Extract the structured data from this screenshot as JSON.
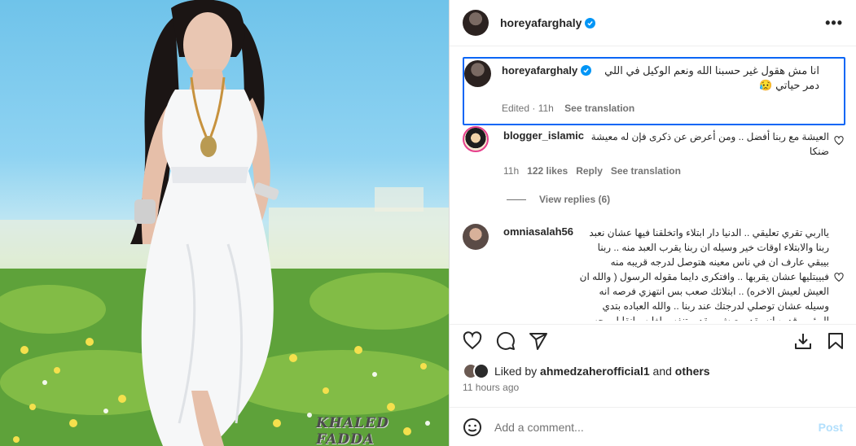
{
  "post": {
    "image_alt_icon": "photo",
    "watermark": "KHALED FADDA"
  },
  "header": {
    "username": "horeyafarghaly",
    "more_label": "•••"
  },
  "caption": {
    "username": "horeyafarghaly",
    "text": "انا مش هقول غير حسبنا الله ونعم الوكيل في اللي دمر حياتي 😥",
    "edited": "Edited · 11h",
    "see_translation": "See translation"
  },
  "comments": [
    {
      "username": "blogger_islamic",
      "text": "العيشة مع ربنا أفضل .. ومن أعرض عن ذكرى فإن له معيشة ضنكا",
      "time": "11h",
      "likes": "122 likes",
      "reply": "Reply",
      "see_translation": "See translation",
      "view_replies": "View replies (6)"
    },
    {
      "username": "omniasalah56",
      "text": "يااربي تقري تعليقي .. الدنيا دار ابتلاء واتخلقنا فيها عشان نعبد ربنا والابتلاء اوقات خير وسيله ان ربنا يقرب العبد منه .. ربنا بيبقي عارف ان في ناس معينه هتوصل لدرجه قريبه منه فبيبتليها عشان يقربها .. وافتكرى دايما مقوله الرسول ( والله ان العيش لعيش الاخره) .. ابتلائك صعب بس انتهزي فرصه انه وسيله عشان توصلي لدرجتك عند ربنا .. والله العباده بتدي المؤمن قدره انه يقدر يعيش ويقدر يتنفس لغايه مانقابل وجه الله الكريم"
    }
  ],
  "actions": {
    "like_icon": "heart-icon",
    "comment_icon": "comment-icon",
    "share_icon": "share-icon",
    "download_icon": "download-icon",
    "save_icon": "bookmark-icon"
  },
  "likes": {
    "prefix": "Liked by ",
    "user": "ahmedzaherofficial1",
    "and": " and ",
    "others": "others"
  },
  "timestamp": "11 hours ago",
  "add_comment": {
    "placeholder": "Add a comment...",
    "post_label": "Post"
  },
  "colors": {
    "verified": "#0095f6",
    "highlight_border": "#0a66f5",
    "post_disabled": "#b2dffc"
  }
}
